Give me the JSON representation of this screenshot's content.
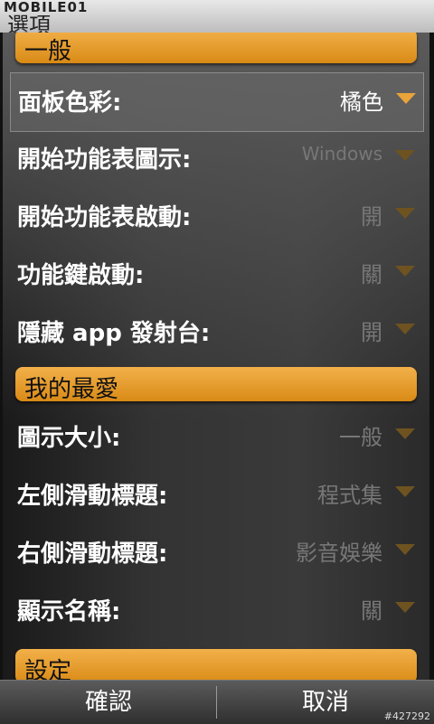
{
  "header": {
    "logo": "MOBILE01",
    "title": "選項"
  },
  "sections": [
    {
      "title": "一般",
      "items": [
        {
          "label": "面板色彩:",
          "value": "橘色",
          "selected": true
        },
        {
          "label": "開始功能表圖示:",
          "value": "Windows"
        },
        {
          "label": "開始功能表啟動:",
          "value": "開"
        },
        {
          "label": "功能鍵啟動:",
          "value": "關"
        },
        {
          "label": "隱藏 app 發射台:",
          "value": "開"
        }
      ]
    },
    {
      "title": "我的最愛",
      "items": [
        {
          "label": "圖示大小:",
          "value": "一般"
        },
        {
          "label": "左側滑動標題:",
          "value": "程式集"
        },
        {
          "label": "右側滑動標題:",
          "value": "影音娛樂"
        },
        {
          "label": "顯示名稱:",
          "value": "關"
        }
      ]
    },
    {
      "title": "設定",
      "items": []
    }
  ],
  "softkeys": {
    "left": "確認",
    "right": "取消"
  },
  "watermark": "#427292",
  "colors": {
    "accent": "#e8a33a",
    "section_bar": "#d98a16"
  }
}
